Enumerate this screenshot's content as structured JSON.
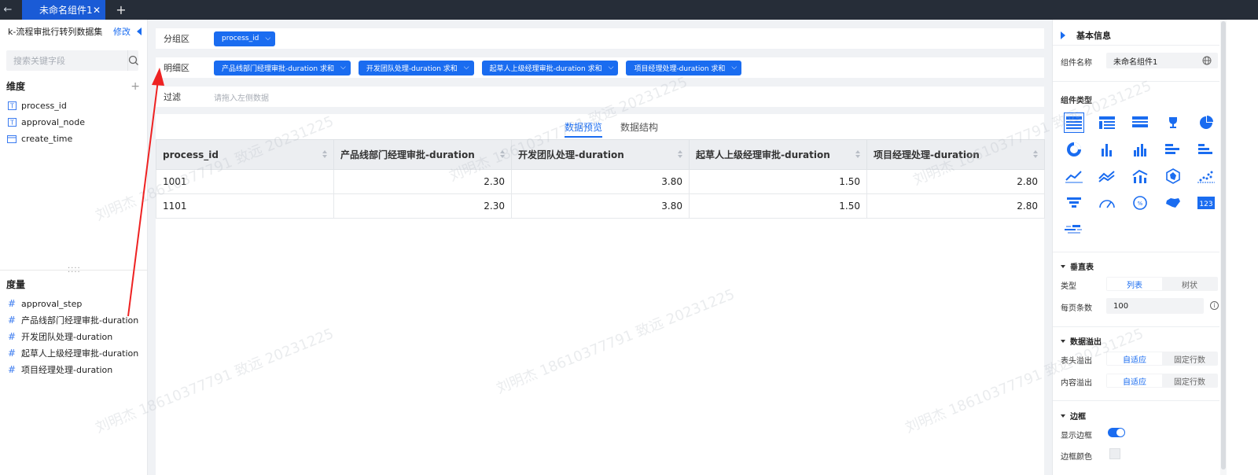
{
  "topbar": {
    "tab_title": "未命名组件1",
    "close_glyph": "✕",
    "add_glyph": "+",
    "back_glyph": "←"
  },
  "left": {
    "dataset_name": "k-流程审批行转列数据集",
    "edit_label": "修改",
    "search_placeholder": "搜索关键字段",
    "dimension_title": "维度",
    "dimensions": [
      {
        "name": "process_id",
        "icon": "text-field-icon"
      },
      {
        "name": "approval_node",
        "icon": "text-field-icon"
      },
      {
        "name": "create_time",
        "icon": "calendar-icon"
      }
    ],
    "measure_title": "度量",
    "measures": [
      {
        "name": "approval_step"
      },
      {
        "name": "产品线部门经理审批-duration"
      },
      {
        "name": "开发团队处理-duration"
      },
      {
        "name": "起草人上级经理审批-duration"
      },
      {
        "name": "项目经理处理-duration"
      }
    ]
  },
  "center": {
    "group_zone": {
      "label": "分组区",
      "pills": [
        "process_id"
      ]
    },
    "detail_zone": {
      "label": "明细区",
      "pills": [
        "产品线部门经理审批-duration  求和",
        "开发团队处理-duration  求和",
        "起草人上级经理审批-duration  求和",
        "项目经理处理-duration  求和"
      ]
    },
    "filter_zone": {
      "label": "过滤",
      "placeholder": "请拖入左侧数据"
    },
    "tabs": [
      "数据预览",
      "数据结构"
    ],
    "table": {
      "columns": [
        "process_id",
        "产品线部门经理审批-duration",
        "开发团队处理-duration",
        "起草人上级经理审批-duration",
        "项目经理处理-duration"
      ],
      "rows": [
        [
          "1001",
          "2.30",
          "3.80",
          "1.50",
          "2.80"
        ],
        [
          "1101",
          "2.30",
          "3.80",
          "1.50",
          "2.80"
        ]
      ]
    }
  },
  "right": {
    "basic_info_title": "基本信息",
    "component_name_label": "组件名称",
    "component_name_value": "未命名组件1",
    "component_type_title": "组件类型",
    "chart_types": [
      "table-list-icon",
      "table-cross-icon",
      "table-grouped-icon",
      "trophy-icon",
      "pie-chart-icon",
      "donut-chart-icon",
      "bar-chart-icon",
      "grouped-bar-chart-icon",
      "horizontal-bar-icon",
      "stacked-horizontal-bar-icon",
      "line-chart-icon",
      "area-chart-icon",
      "combo-chart-icon",
      "radar-chart-icon",
      "scatter-chart-icon",
      "funnel-chart-icon",
      "gauge-chart-icon",
      "percent-ring-icon",
      "map-chart-icon",
      "number-card-icon",
      "word-cloud-icon"
    ],
    "vertical_table_title": "垂直表",
    "type_label": "类型",
    "type_options": [
      "列表",
      "树状"
    ],
    "page_size_label": "每页条数",
    "page_size_value": "100",
    "overflow_title": "数据溢出",
    "header_overflow_label": "表头溢出",
    "content_overflow_label": "内容溢出",
    "overflow_options": [
      "自适应",
      "固定行数"
    ],
    "border_title": "边框",
    "show_border_label": "显示边框",
    "border_color_label": "边框颜色",
    "info_glyph": "i"
  },
  "watermark": "刘明杰 18610377791 致远 20231225",
  "colors": {
    "accent": "#1a6cf0",
    "topbar": "#262d38",
    "annotation_arrow": "#ee2222"
  }
}
